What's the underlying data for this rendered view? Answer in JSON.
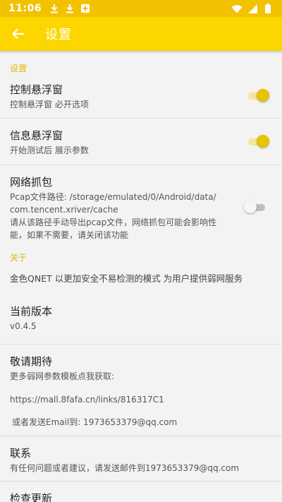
{
  "status": {
    "time": "11:06"
  },
  "header": {
    "title": "设置"
  },
  "sections": {
    "settings": "设置",
    "about": "关于"
  },
  "items": {
    "control_float": {
      "title": "控制悬浮窗",
      "summary": "控制悬浮窗 必开选项",
      "checked": true
    },
    "info_float": {
      "title": "信息悬浮窗",
      "summary": "开始测试后 展示参数",
      "checked": true
    },
    "capture": {
      "title": "网络抓包",
      "path_line1": "Pcap文件路径: /storage/emulated/0/Android/data/",
      "path_line2": "com.tencent.xriver/cache",
      "note_line1": "请从该路径手动导出pcap文件，网络抓包可能会影响性",
      "note_line2": "能，如果不需要，请关闭该功能",
      "checked": false
    },
    "about_text": "金色QNET 以更加安全不易检测的模式 为用户提供弱网服务",
    "version": {
      "title": "当前版本",
      "value": "v0.4.5"
    },
    "stay_tuned": {
      "title": "敬请期待",
      "line1": "更多弱网参数模板点我获取:",
      "link": "https://mall.8fafa.cn/links/816317C1",
      "email": "或者发送Email到: 1973653379@qq.com"
    },
    "contact": {
      "title": "联系",
      "summary": "有任何问题或者建议，请发送邮件到1973653379@qq.com"
    },
    "update": {
      "title": "检查更新"
    }
  },
  "colors": {
    "accent": "#fdd600",
    "status_bar": "#f2c200",
    "section_header": "#e1b800"
  },
  "icons": {
    "status_left": [
      "download-icon",
      "download-icon",
      "app-notification-icon"
    ],
    "status_right": [
      "wifi-icon",
      "signal-icon",
      "battery-icon"
    ],
    "back": "arrow-left-icon"
  }
}
